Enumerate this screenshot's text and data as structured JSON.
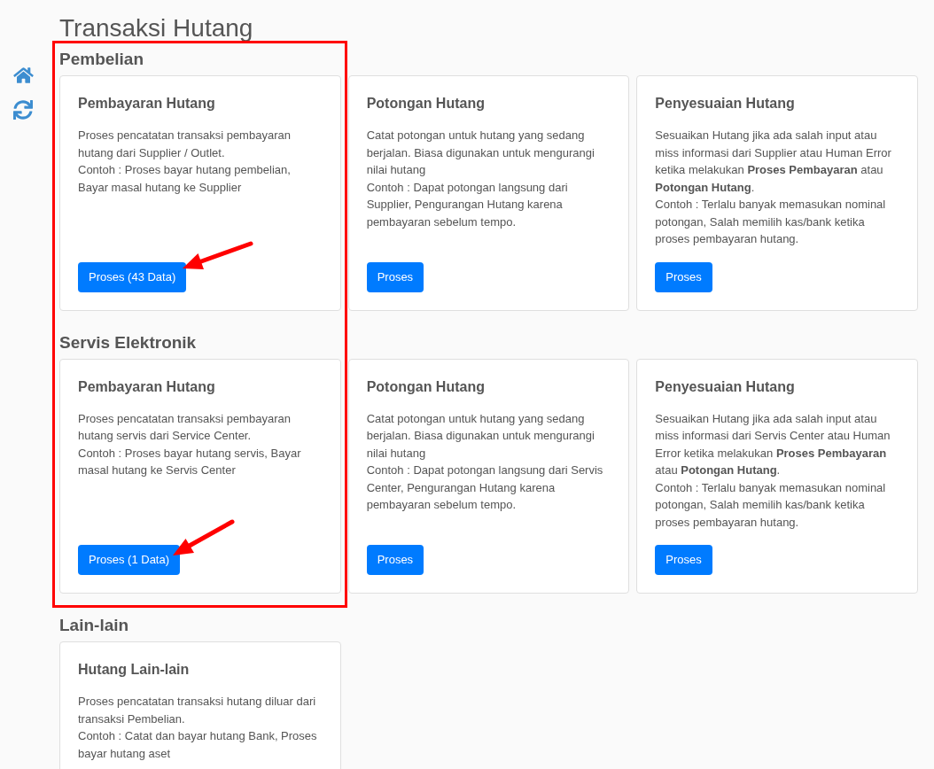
{
  "title": "Transaksi Hutang",
  "sections": [
    {
      "heading": "Pembelian",
      "cards": [
        {
          "title": "Pembayaran Hutang",
          "description": [
            "Proses pencatatan transaksi pembayaran hutang dari Supplier / Outlet.",
            "Contoh : Proses bayar hutang pembelian, Bayar masal hutang ke Supplier"
          ],
          "button": "Proses (43 Data)"
        },
        {
          "title": "Potongan Hutang",
          "description": [
            "Catat potongan untuk hutang yang sedang berjalan. Biasa digunakan untuk mengurangi nilai hutang",
            "Contoh : Dapat potongan langsung dari Supplier, Pengurangan Hutang karena pembayaran sebelum tempo."
          ],
          "button": "Proses"
        },
        {
          "title": "Penyesuaian Hutang",
          "description": [
            "Sesuaikan Hutang jika ada salah input atau miss informasi dari Supplier atau Human Error ketika melakukan **Proses Pembayaran** atau **Potongan Hutang**.",
            "Contoh : Terlalu banyak memasukan nominal potongan, Salah memilih kas/bank ketika proses pembayaran hutang."
          ],
          "button": "Proses"
        }
      ]
    },
    {
      "heading": "Servis Elektronik",
      "cards": [
        {
          "title": "Pembayaran Hutang",
          "description": [
            "Proses pencatatan transaksi pembayaran hutang servis dari Service Center.",
            "Contoh : Proses bayar hutang servis, Bayar masal hutang ke Servis Center"
          ],
          "button": "Proses (1 Data)"
        },
        {
          "title": "Potongan Hutang",
          "description": [
            "Catat potongan untuk hutang yang sedang berjalan. Biasa digunakan untuk mengurangi nilai hutang",
            "Contoh : Dapat potongan langsung dari Servis Center, Pengurangan Hutang karena pembayaran sebelum tempo."
          ],
          "button": "Proses"
        },
        {
          "title": "Penyesuaian Hutang",
          "description": [
            "Sesuaikan Hutang jika ada salah input atau miss informasi dari Servis Center atau Human Error ketika melakukan **Proses Pembayaran** atau **Potongan Hutang**.",
            "Contoh : Terlalu banyak memasukan nominal potongan, Salah memilih kas/bank ketika proses pembayaran hutang."
          ],
          "button": "Proses"
        }
      ]
    },
    {
      "heading": "Lain-lain",
      "cards": [
        {
          "title": "Hutang Lain-lain",
          "description": [
            "Proses pencatatan transaksi hutang diluar dari transaksi Pembelian.",
            "Contoh : Catat dan bayar hutang Bank, Proses bayar hutang aset"
          ]
        }
      ]
    }
  ]
}
